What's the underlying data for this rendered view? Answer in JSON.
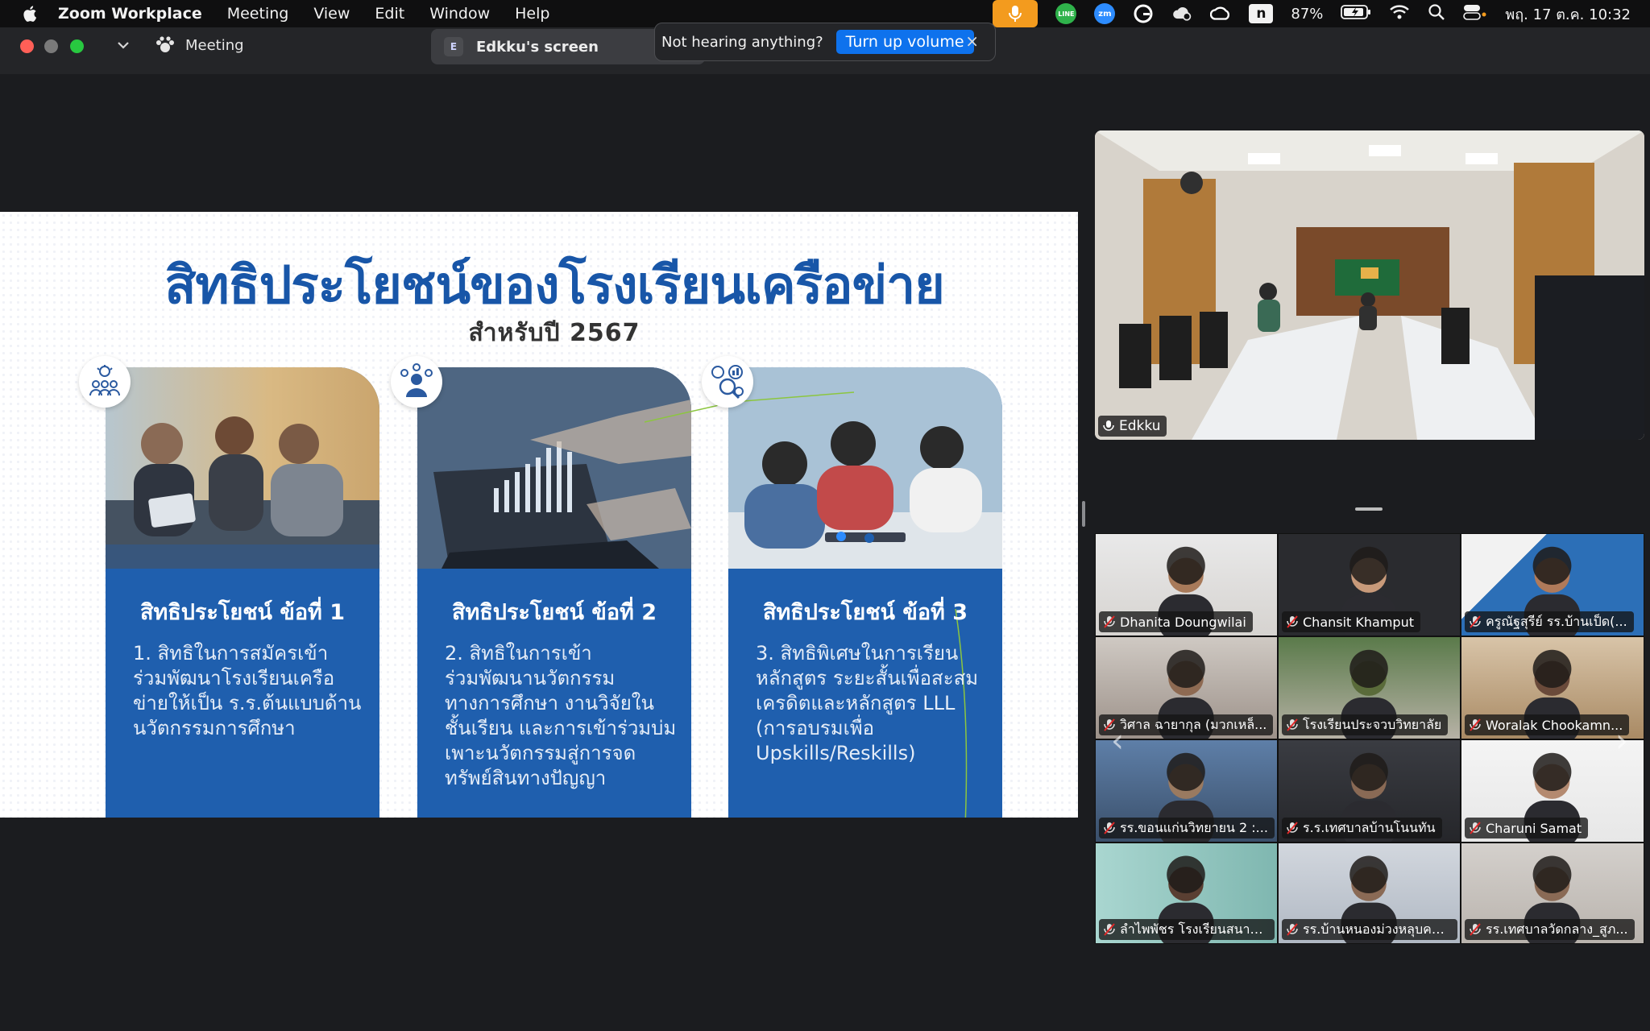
{
  "menubar": {
    "app_name": "Zoom Workplace",
    "items": [
      "Meeting",
      "View",
      "Edit",
      "Window",
      "Help"
    ],
    "tray": {
      "line_label": "LINE",
      "zoom_label": "zm",
      "n_label": "n",
      "battery": "87%",
      "clock": "พฤ. 17 ต.ค. 10:32"
    }
  },
  "titlebar": {
    "meeting_label": "Meeting",
    "screen_badge": "E",
    "screen_label": "Edkku's screen"
  },
  "toast": {
    "message": "Not hearing anything?",
    "button_label": "Turn up volume",
    "close_label": "×"
  },
  "slide": {
    "title": "สิทธิประโยชน์ของโรงเรียนเครือข่าย",
    "subtitle": "สำหรับปี 2567",
    "cards": [
      {
        "heading": "สิทธิประโยชน์ ข้อที่ 1",
        "body": "1. สิทธิในการสมัครเข้าร่วมพัฒนาโรงเรียนเครือข่ายให้เป็น ร.ร.ต้นแบบด้านนวัตกรรมการศึกษา"
      },
      {
        "heading": "สิทธิประโยชน์ ข้อที่ 2",
        "body": "2. สิทธิในการเข้าร่วมพัฒนานวัตกรรมทางการศึกษา งานวิจัยในชั้นเรียน และการเข้าร่วมบ่มเพาะนวัตกรรมสู่การจดทรัพย์สินทางปัญญา"
      },
      {
        "heading": "สิทธิประโยชน์ ข้อที่ 3",
        "body": "3. สิทธิพิเศษในการเรียนหลักสูตร ระยะสั้นเพื่อสะสมเครดิตและหลักสูตร LLL (การอบรมเพื่อ Upskills/Reskills)"
      }
    ]
  },
  "speaker": {
    "name": "Edkku"
  },
  "participants": [
    {
      "name": "Dhanita Doungwilai"
    },
    {
      "name": "Chansit Khamput"
    },
    {
      "name": "ครูณัฐสุรีย์ รร.บ้านเป็ด(..."
    },
    {
      "name": "วิศาล ฉายากุล (มวกเหล็..."
    },
    {
      "name": "โรงเรียนประจวบวิทยาลัย"
    },
    {
      "name": "Woralak Chookamn..."
    },
    {
      "name": "รร.ขอนแก่นวิทยายน 2 :..."
    },
    {
      "name": "ร.ร.เทศบาลบ้านโนนทัน"
    },
    {
      "name": "Charuni Samat"
    },
    {
      "name": "ลำไพพัชร โรงเรียนสนาม..."
    },
    {
      "name": "รร.บ้านหนองม่วงหลุบคา..."
    },
    {
      "name": "รร.เทศบาลวัดกลาง_สูภ..."
    }
  ],
  "colors": {
    "slide_blue": "#1f5fae",
    "title_blue": "#1856a8",
    "zoom_blue": "#0e72ed",
    "mic_orange": "#f39b1e"
  }
}
